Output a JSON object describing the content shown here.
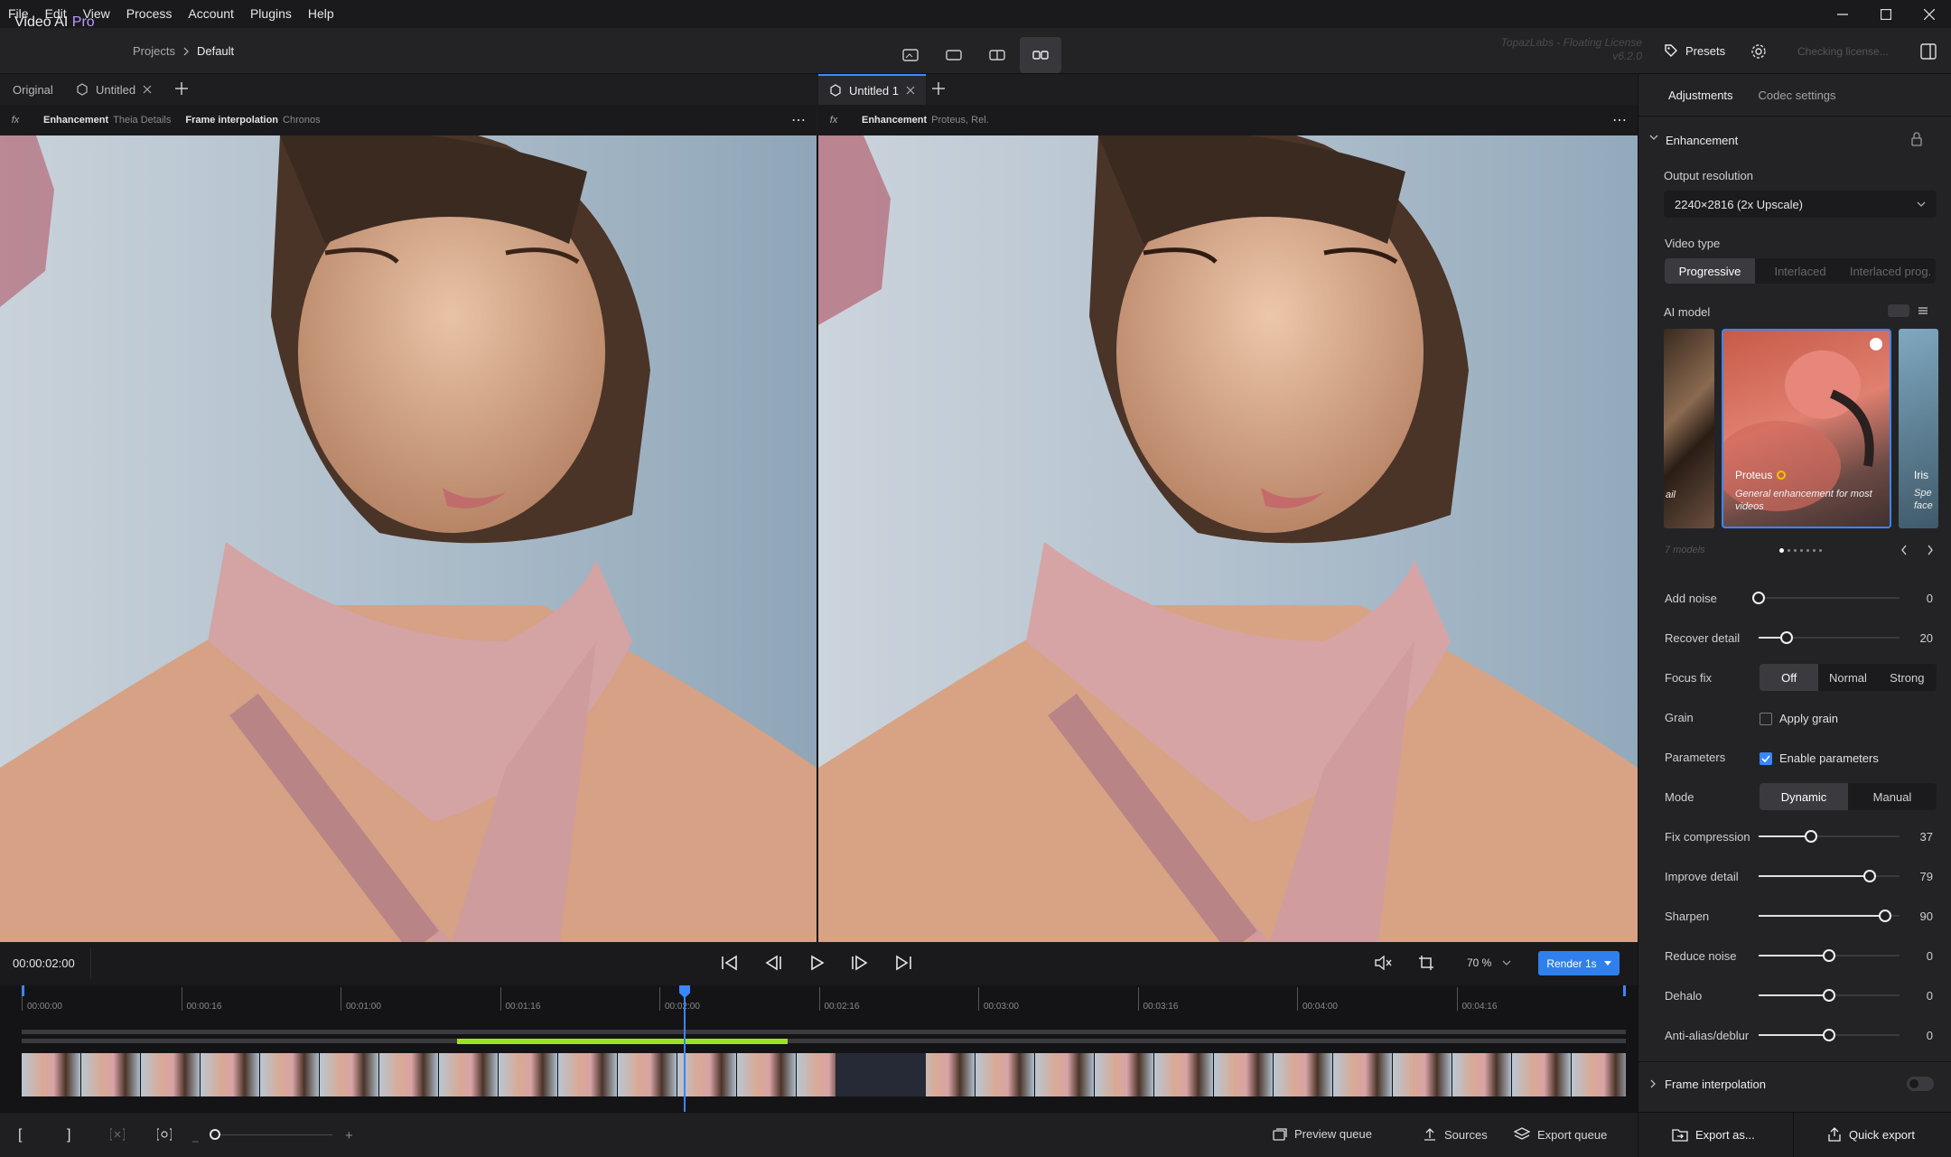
{
  "menu": [
    "File",
    "Edit",
    "View",
    "Process",
    "Account",
    "Plugins",
    "Help"
  ],
  "window_controls": [
    "minimize-icon",
    "maximize-icon",
    "close-icon"
  ],
  "app": {
    "name": "Video AI",
    "edition": "Pro"
  },
  "breadcrumb": {
    "parent": "Projects",
    "current": "Default"
  },
  "license": {
    "line1": "TopazLabs - Floating License",
    "line2": "v6.2.0",
    "status": "Checking license..."
  },
  "presets_label": "Presets",
  "left_tabs": {
    "original": "Original",
    "untitled": "Untitled"
  },
  "right_tabs": {
    "untitled": "Untitled 1"
  },
  "left_pipeline": {
    "enh_label": "Enhancement",
    "enh_model": "Theia Details",
    "fi_label": "Frame interpolation",
    "fi_model": "Chronos"
  },
  "right_pipeline": {
    "enh_label": "Enhancement",
    "enh_model": "Proteus, Rel."
  },
  "panel": {
    "tabs": [
      "Adjustments",
      "Codec settings"
    ],
    "enhancement": "Enhancement",
    "output_resolution_label": "Output resolution",
    "output_resolution_value": "2240×2816 (2x Upscale)",
    "video_type_label": "Video type",
    "video_types": [
      "Progressive",
      "Interlaced",
      "Interlaced prog."
    ],
    "ai_model_label": "AI model",
    "model_left_fragment": "ail",
    "model_main": {
      "name": "Proteus",
      "desc": "General enhancement for most videos"
    },
    "model_right": {
      "name": "Iris",
      "desc1": "Spe",
      "desc2": "face"
    },
    "models_count": "7 models",
    "add_noise": {
      "label": "Add noise",
      "value": 0
    },
    "recover_detail": {
      "label": "Recover detail",
      "value": 20
    },
    "focus_fix": {
      "label": "Focus fix",
      "options": [
        "Off",
        "Normal",
        "Strong"
      ]
    },
    "grain": {
      "label": "Grain",
      "checkbox": "Apply grain"
    },
    "parameters": {
      "label": "Parameters",
      "checkbox": "Enable parameters"
    },
    "mode": {
      "label": "Mode",
      "options": [
        "Dynamic",
        "Manual"
      ]
    },
    "fix_compression": {
      "label": "Fix compression",
      "value": 37
    },
    "improve_detail": {
      "label": "Improve detail",
      "value": 79
    },
    "sharpen": {
      "label": "Sharpen",
      "value": 90
    },
    "reduce_noise": {
      "label": "Reduce noise",
      "value": 0
    },
    "dehalo": {
      "label": "Dehalo",
      "value": 0
    },
    "anti_alias": {
      "label": "Anti-alias/deblur",
      "value": 0
    },
    "frame_interpolation": "Frame interpolation"
  },
  "transport": {
    "timecode": "00:00:02:00",
    "zoom": "70 %",
    "render": "Render 1s"
  },
  "timeline_ticks": [
    "00:00:00",
    "00:00:16",
    "00:01:00",
    "00:01:16",
    "00:02:00",
    "00:02:16",
    "00:03:00",
    "00:03:16",
    "00:04:00",
    "00:04:16"
  ],
  "footer": {
    "preview_queue": "Preview queue",
    "sources": "Sources",
    "export_queue": "Export queue",
    "export_as": "Export as...",
    "quick_export": "Quick export"
  },
  "colors": {
    "accent": "#3a86ff",
    "pro": "#b99bff",
    "render_progress": "#9be320"
  }
}
